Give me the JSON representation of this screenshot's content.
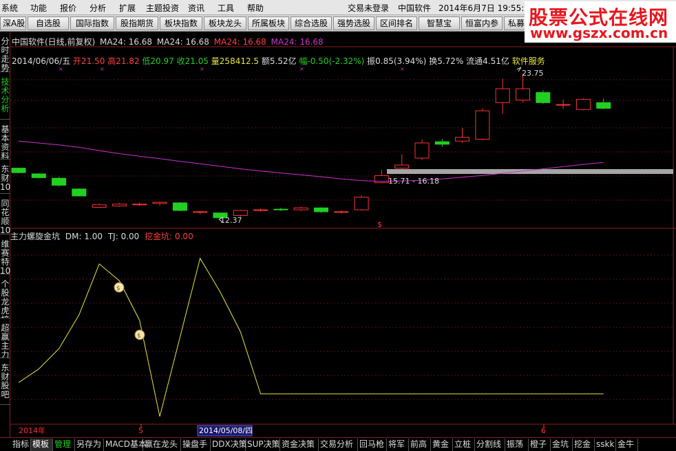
{
  "menubar": {
    "items": [
      "系统",
      "功能",
      "报价",
      "分析",
      "扩展",
      "主题投资",
      "资讯",
      "工具",
      "帮助"
    ],
    "status": "交易未登录",
    "app_name": "中国软件",
    "datetime": "2014年6月7日  19:55:0"
  },
  "toolbar": {
    "buttons": [
      "深A股",
      "自选股",
      "国际指数",
      "股指期货",
      "板块指数",
      "板块龙头",
      "所属板块",
      "综合选股",
      "强势选股",
      "区间排名",
      "智慧宝",
      "恒富内参",
      "私募"
    ]
  },
  "logo": {
    "line1": "股票公式在线网",
    "line2": "www.gszx.com.cn"
  },
  "sidetabs": [
    {
      "label": "分时走势",
      "active": false
    },
    {
      "label": "技术分析",
      "active": true
    },
    {
      "label": "基本资料",
      "active": false
    },
    {
      "label": "东财10",
      "active": false
    },
    {
      "label": "同花顺10",
      "active": false
    },
    {
      "label": "维赛特10",
      "active": false
    },
    {
      "label": "个股龙虎榜",
      "active": false
    },
    {
      "label": "超赢主力",
      "active": false
    },
    {
      "label": "东财股吧",
      "active": false
    }
  ],
  "price_header": {
    "name": "中国软件(日线,前复权)",
    "ma_label_1": "MA24: 16.68",
    "ma_label_2": "MA24: 16.68",
    "ma_label_3": "MA24: 16.68",
    "ma_label_4": "MA24: 16.68"
  },
  "info_line": {
    "date": "2014/06/06/五",
    "open": "开21.50",
    "high": "高21.82",
    "low": "低20.97",
    "close": "收21.05",
    "volume": "量258412.5",
    "amount": "额5.52亿",
    "change": "幅-0.50(-2.32%)",
    "amplitude": "振0.85(3.94%)",
    "turnover": "换5.72%",
    "float": "流通4.51亿",
    "sector": "软件服务"
  },
  "annotations": {
    "high": "23.75",
    "low": "12.37",
    "range": "15.71 - 16.18"
  },
  "indicator_header": {
    "name": "主力螺旋金坑",
    "dm": "DM: 1.00",
    "tj": "TJ: 0.00",
    "wjk": "挖金坑: 0.00"
  },
  "date_axis": {
    "year": "2014年",
    "month5": "5",
    "cursor_date": "2014/05/08/四",
    "month6": "6"
  },
  "bottomtabs": [
    {
      "label": "指标",
      "state": ""
    },
    {
      "label": "模板",
      "state": "sel"
    },
    {
      "label": "管理",
      "state": "active"
    },
    {
      "label": "另存为",
      "state": ""
    },
    {
      "label": "MACD基本",
      "state": ""
    },
    {
      "label": "赢在龙头",
      "state": ""
    },
    {
      "label": "操盘手",
      "state": ""
    },
    {
      "label": "DDX决策",
      "state": ""
    },
    {
      "label": "SUP决策",
      "state": ""
    },
    {
      "label": "资金决策",
      "state": ""
    },
    {
      "label": "交易分析",
      "state": ""
    },
    {
      "label": "回马枪",
      "state": ""
    },
    {
      "label": "将军",
      "state": ""
    },
    {
      "label": "前高",
      "state": ""
    },
    {
      "label": "黄金",
      "state": ""
    },
    {
      "label": "立桩",
      "state": ""
    },
    {
      "label": "分割线",
      "state": ""
    },
    {
      "label": "振荡",
      "state": ""
    },
    {
      "label": "橙子",
      "state": ""
    },
    {
      "label": "金坑",
      "state": ""
    },
    {
      "label": "挖金",
      "state": ""
    },
    {
      "label": "sskk",
      "state": ""
    },
    {
      "label": "金牛",
      "state": ""
    }
  ],
  "colors": {
    "up": "#ff3232",
    "down": "#21d021",
    "ma": "#cc33cc",
    "indicator": "#e8e840",
    "grid": "#8a1f1f"
  },
  "chart_data": [
    {
      "type": "candlestick",
      "title": "中国软件(日线,前复权)",
      "series": [
        {
          "name": "MA24",
          "type": "line"
        }
      ],
      "candles": [
        {
          "o": 16.3,
          "c": 15.95,
          "h": 16.35,
          "l": 15.9
        },
        {
          "o": 15.85,
          "c": 15.55,
          "h": 15.9,
          "l": 15.5
        },
        {
          "o": 15.5,
          "c": 14.95,
          "h": 15.6,
          "l": 14.85
        },
        {
          "o": 14.65,
          "c": 14.1,
          "h": 14.7,
          "l": 14.05
        },
        {
          "o": 13.2,
          "c": 13.4,
          "h": 13.5,
          "l": 13.15
        },
        {
          "o": 13.3,
          "c": 13.45,
          "h": 13.55,
          "l": 13.25
        },
        {
          "o": 13.4,
          "c": 13.45,
          "h": 13.6,
          "l": 13.3
        },
        {
          "o": 13.5,
          "c": 13.6,
          "h": 13.65,
          "l": 13.35
        },
        {
          "o": 13.55,
          "c": 12.95,
          "h": 13.6,
          "l": 12.9
        },
        {
          "o": 12.8,
          "c": 12.85,
          "h": 12.9,
          "l": 12.65
        },
        {
          "o": 12.75,
          "c": 12.37,
          "h": 12.78,
          "l": 12.3
        },
        {
          "o": 12.55,
          "c": 12.95,
          "h": 13.0,
          "l": 12.45
        },
        {
          "o": 12.95,
          "c": 13.0,
          "h": 13.1,
          "l": 12.85
        },
        {
          "o": 13.05,
          "c": 13.0,
          "h": 13.15,
          "l": 12.9
        },
        {
          "o": 13.0,
          "c": 13.15,
          "h": 13.25,
          "l": 12.9
        },
        {
          "o": 13.15,
          "c": 12.85,
          "h": 13.2,
          "l": 12.75
        },
        {
          "o": 12.8,
          "c": 12.85,
          "h": 12.95,
          "l": 12.7
        },
        {
          "o": 13.0,
          "c": 14.0,
          "h": 14.15,
          "l": 12.95
        },
        {
          "o": 15.15,
          "c": 15.71,
          "h": 16.18,
          "l": 15.1
        },
        {
          "o": 16.3,
          "c": 16.55,
          "h": 17.4,
          "l": 16.2
        },
        {
          "o": 17.1,
          "c": 18.3,
          "h": 18.6,
          "l": 16.95
        },
        {
          "o": 18.4,
          "c": 18.2,
          "h": 18.6,
          "l": 18.0
        },
        {
          "o": 18.45,
          "c": 18.75,
          "h": 19.5,
          "l": 18.3
        },
        {
          "o": 18.6,
          "c": 20.85,
          "h": 21.05,
          "l": 18.5
        },
        {
          "o": 21.5,
          "c": 22.6,
          "h": 23.4,
          "l": 20.6
        },
        {
          "o": 21.7,
          "c": 22.6,
          "h": 23.75,
          "l": 21.5
        },
        {
          "o": 22.3,
          "c": 21.5,
          "h": 22.5,
          "l": 21.4
        },
        {
          "o": 21.3,
          "c": 21.35,
          "h": 21.75,
          "l": 21.0
        },
        {
          "o": 20.95,
          "c": 21.75,
          "h": 21.85,
          "l": 20.9
        },
        {
          "o": 21.5,
          "c": 21.05,
          "h": 21.82,
          "l": 20.97
        }
      ],
      "ma24": [
        18.45,
        18.3,
        18.15,
        17.95,
        17.7,
        17.45,
        17.25,
        17.05,
        16.85,
        16.65,
        16.45,
        16.25,
        16.08,
        15.92,
        15.78,
        15.62,
        15.45,
        15.32,
        15.25,
        15.28,
        15.35,
        15.45,
        15.58,
        15.72,
        15.9,
        16.08,
        16.25,
        16.42,
        16.6,
        16.75
      ]
    },
    {
      "type": "line",
      "title": "主力螺旋金坑",
      "series": [
        {
          "name": "DM",
          "values": [
            3.0,
            4.2,
            6.0,
            9.0,
            13.5,
            12.0,
            8.5,
            0.0,
            7.0,
            14.0,
            11.0,
            7.5,
            2.0,
            2.0,
            2.0,
            2.0,
            2.0,
            2.0,
            2.0,
            2.0,
            2.0,
            2.0,
            2.0,
            2.0,
            2.0,
            2.0,
            2.0,
            2.0,
            2.0,
            2.0
          ]
        }
      ],
      "ylim": [
        -0.5,
        15.5
      ]
    }
  ]
}
